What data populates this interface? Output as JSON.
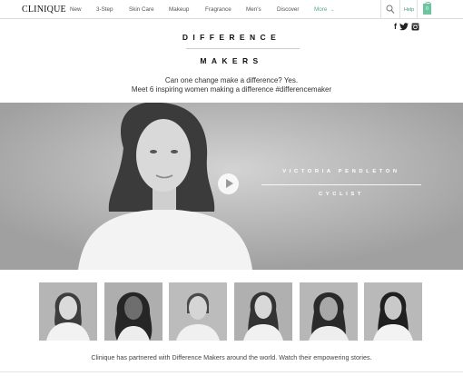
{
  "nav": {
    "logo": "CLINIQUE",
    "items": [
      "New",
      "3-Step",
      "Skin Care",
      "Makeup",
      "Fragrance",
      "Men's",
      "Discover",
      "More"
    ],
    "help": "Help",
    "bag_count": "0",
    "accent_color": "#5aa785"
  },
  "header": {
    "title_line1": "DIFFERENCE",
    "title_line2": "MAKERS",
    "intro_line1": "Can one change make a difference? Yes.",
    "intro_line2": "Meet 6 inspiring women making a difference #differencemaker",
    "social_icons": [
      "facebook-icon",
      "twitter-icon",
      "instagram-icon"
    ]
  },
  "hero": {
    "name": "VICTORIA PENDLETON",
    "role": "CYCLIST"
  },
  "thumbnails": [
    "portrait-1",
    "portrait-2",
    "portrait-3",
    "portrait-4",
    "portrait-5",
    "portrait-6"
  ],
  "footer": {
    "caption": "Clinique has partnered with Difference Makers around the world. Watch their empowering stories."
  }
}
